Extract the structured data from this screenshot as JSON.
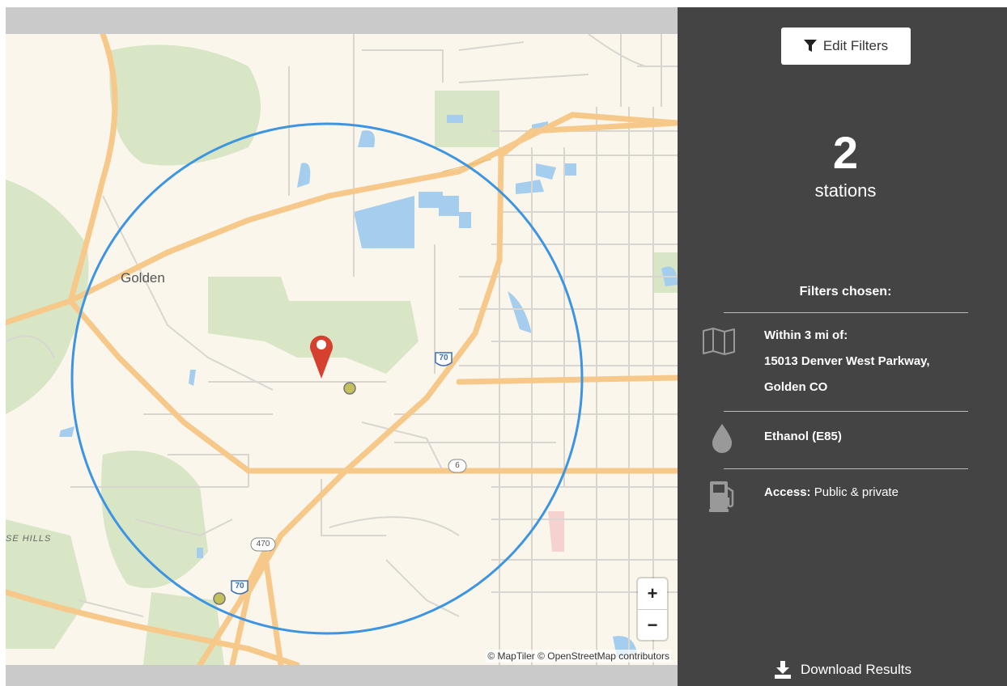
{
  "map": {
    "place_label": "Golden",
    "hills_label": "SE HILLS",
    "shields": [
      "70",
      "70",
      "6",
      "470"
    ],
    "attribution": "© MapTiler © OpenStreetMap contributors",
    "zoom_in": "+",
    "zoom_out": "−"
  },
  "panel": {
    "edit_filters_label": "Edit Filters",
    "station_count": "2",
    "station_label": "stations",
    "filters_title": "Filters chosen:",
    "location_line1": "Within 3 mi of:",
    "location_line2": "15013 Denver West Parkway,",
    "location_line3": "Golden CO",
    "fuel": "Ethanol (E85)",
    "access_label": "Access:",
    "access_value": "Public & private",
    "download_label": "Download Results"
  },
  "colors": {
    "panel_bg": "#444444",
    "radius_circle": "#3d95e2",
    "marker": "#d6402e",
    "station_dot": "#c3c05e"
  }
}
